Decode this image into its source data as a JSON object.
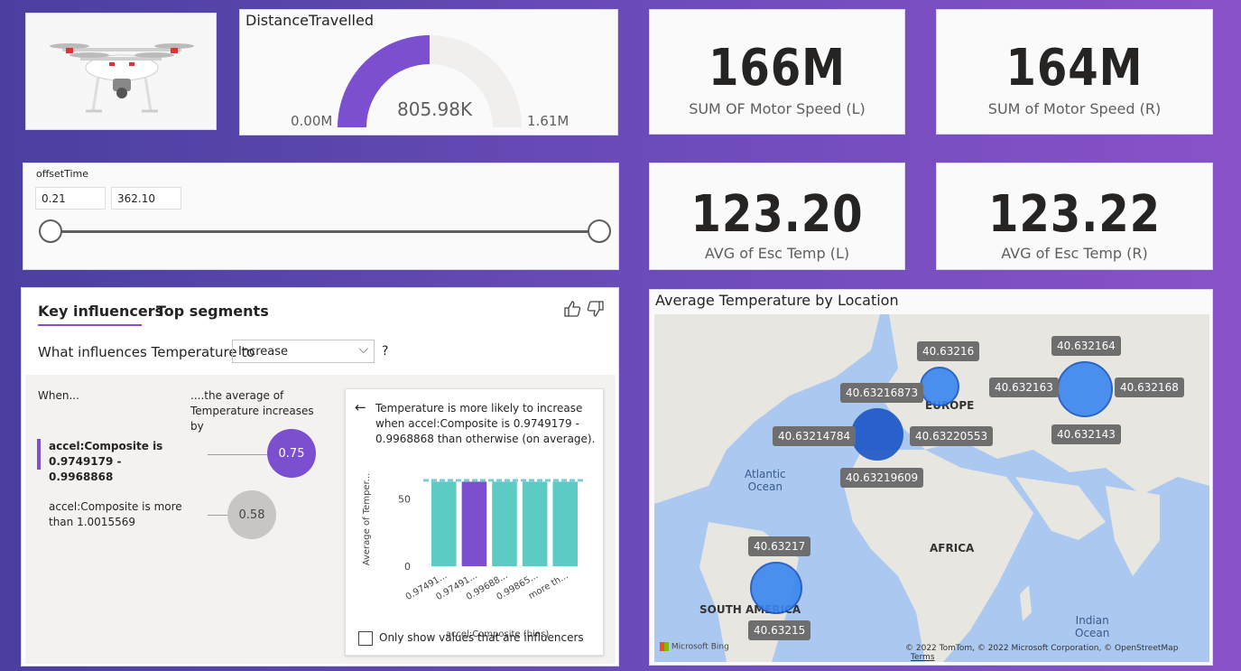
{
  "gauge": {
    "title": "DistanceTravelled",
    "value_label": "805.98K",
    "min_label": "0.00M",
    "max_label": "1.61M",
    "fill_fraction": 0.5,
    "fill_color": "#7b4fcf"
  },
  "cards": [
    {
      "value": "166M",
      "label": "SUM OF Motor Speed (L)"
    },
    {
      "value": "164M",
      "label": "SUM of Motor Speed (R)"
    },
    {
      "value": "123.20",
      "label": "AVG of Esc Temp (L)"
    },
    {
      "value": "123.22",
      "label": "AVG of Esc Temp (R)"
    }
  ],
  "slicer": {
    "title": "offsetTime",
    "min_value": "0.21",
    "max_value": "362.10"
  },
  "key_influencers": {
    "tab_active": "Key influencers",
    "tab_other": "Top segments",
    "question": "What influences Temperature to",
    "dropdown_value": "Increase",
    "question_mark": "?",
    "when_header": "When...",
    "avg_header": "....the average of Temperature increases by",
    "influencers": [
      {
        "label": "accel:Composite is 0.9749179 - 0.9968868",
        "value": "0.75"
      },
      {
        "label": "accel:Composite is more than 1.0015569",
        "value": "0.58"
      }
    ],
    "detail": {
      "back_arrow": "←",
      "text": "Temperature is more likely to increase when accel:Composite is 0.9749179 - 0.9968868 than otherwise (on average).",
      "checkbox_label": "Only show values that are influencers"
    }
  },
  "chart_data": {
    "type": "bar",
    "title": "",
    "xlabel": "accel:Composite (bins)",
    "ylabel": "Average of Temper...",
    "categories": [
      "0.97491...",
      "0.97491...",
      "0.99688...",
      "0.99865...",
      "more th..."
    ],
    "values": [
      63,
      63,
      63,
      63,
      63
    ],
    "highlight_index": 1,
    "average_line": 64,
    "ylim": [
      0,
      70
    ],
    "yticks": [
      0,
      50
    ],
    "colors": {
      "normal": "#5ccbc4",
      "highlight": "#7b4fcf",
      "average": "#7ecbd8"
    }
  },
  "map": {
    "title": "Average Temperature by Location",
    "labels": [
      "40.63216",
      "40.632164",
      "40.632163",
      "40.632168",
      "40.63216873",
      "40.63214784",
      "40.63220553",
      "40.632143",
      "40.63219609",
      "40.63217",
      "40.63215"
    ],
    "oceans": [
      "Atlantic\nOcean",
      "Indian\nOcean"
    ],
    "regions": [
      "EUROPE",
      "AFRICA",
      "SOUTH AMERICA"
    ],
    "attribution_left": "Microsoft Bing",
    "attribution_right": "© 2022 TomTom, © 2022 Microsoft Corporation, © OpenStreetMap",
    "terms": "Terms"
  }
}
